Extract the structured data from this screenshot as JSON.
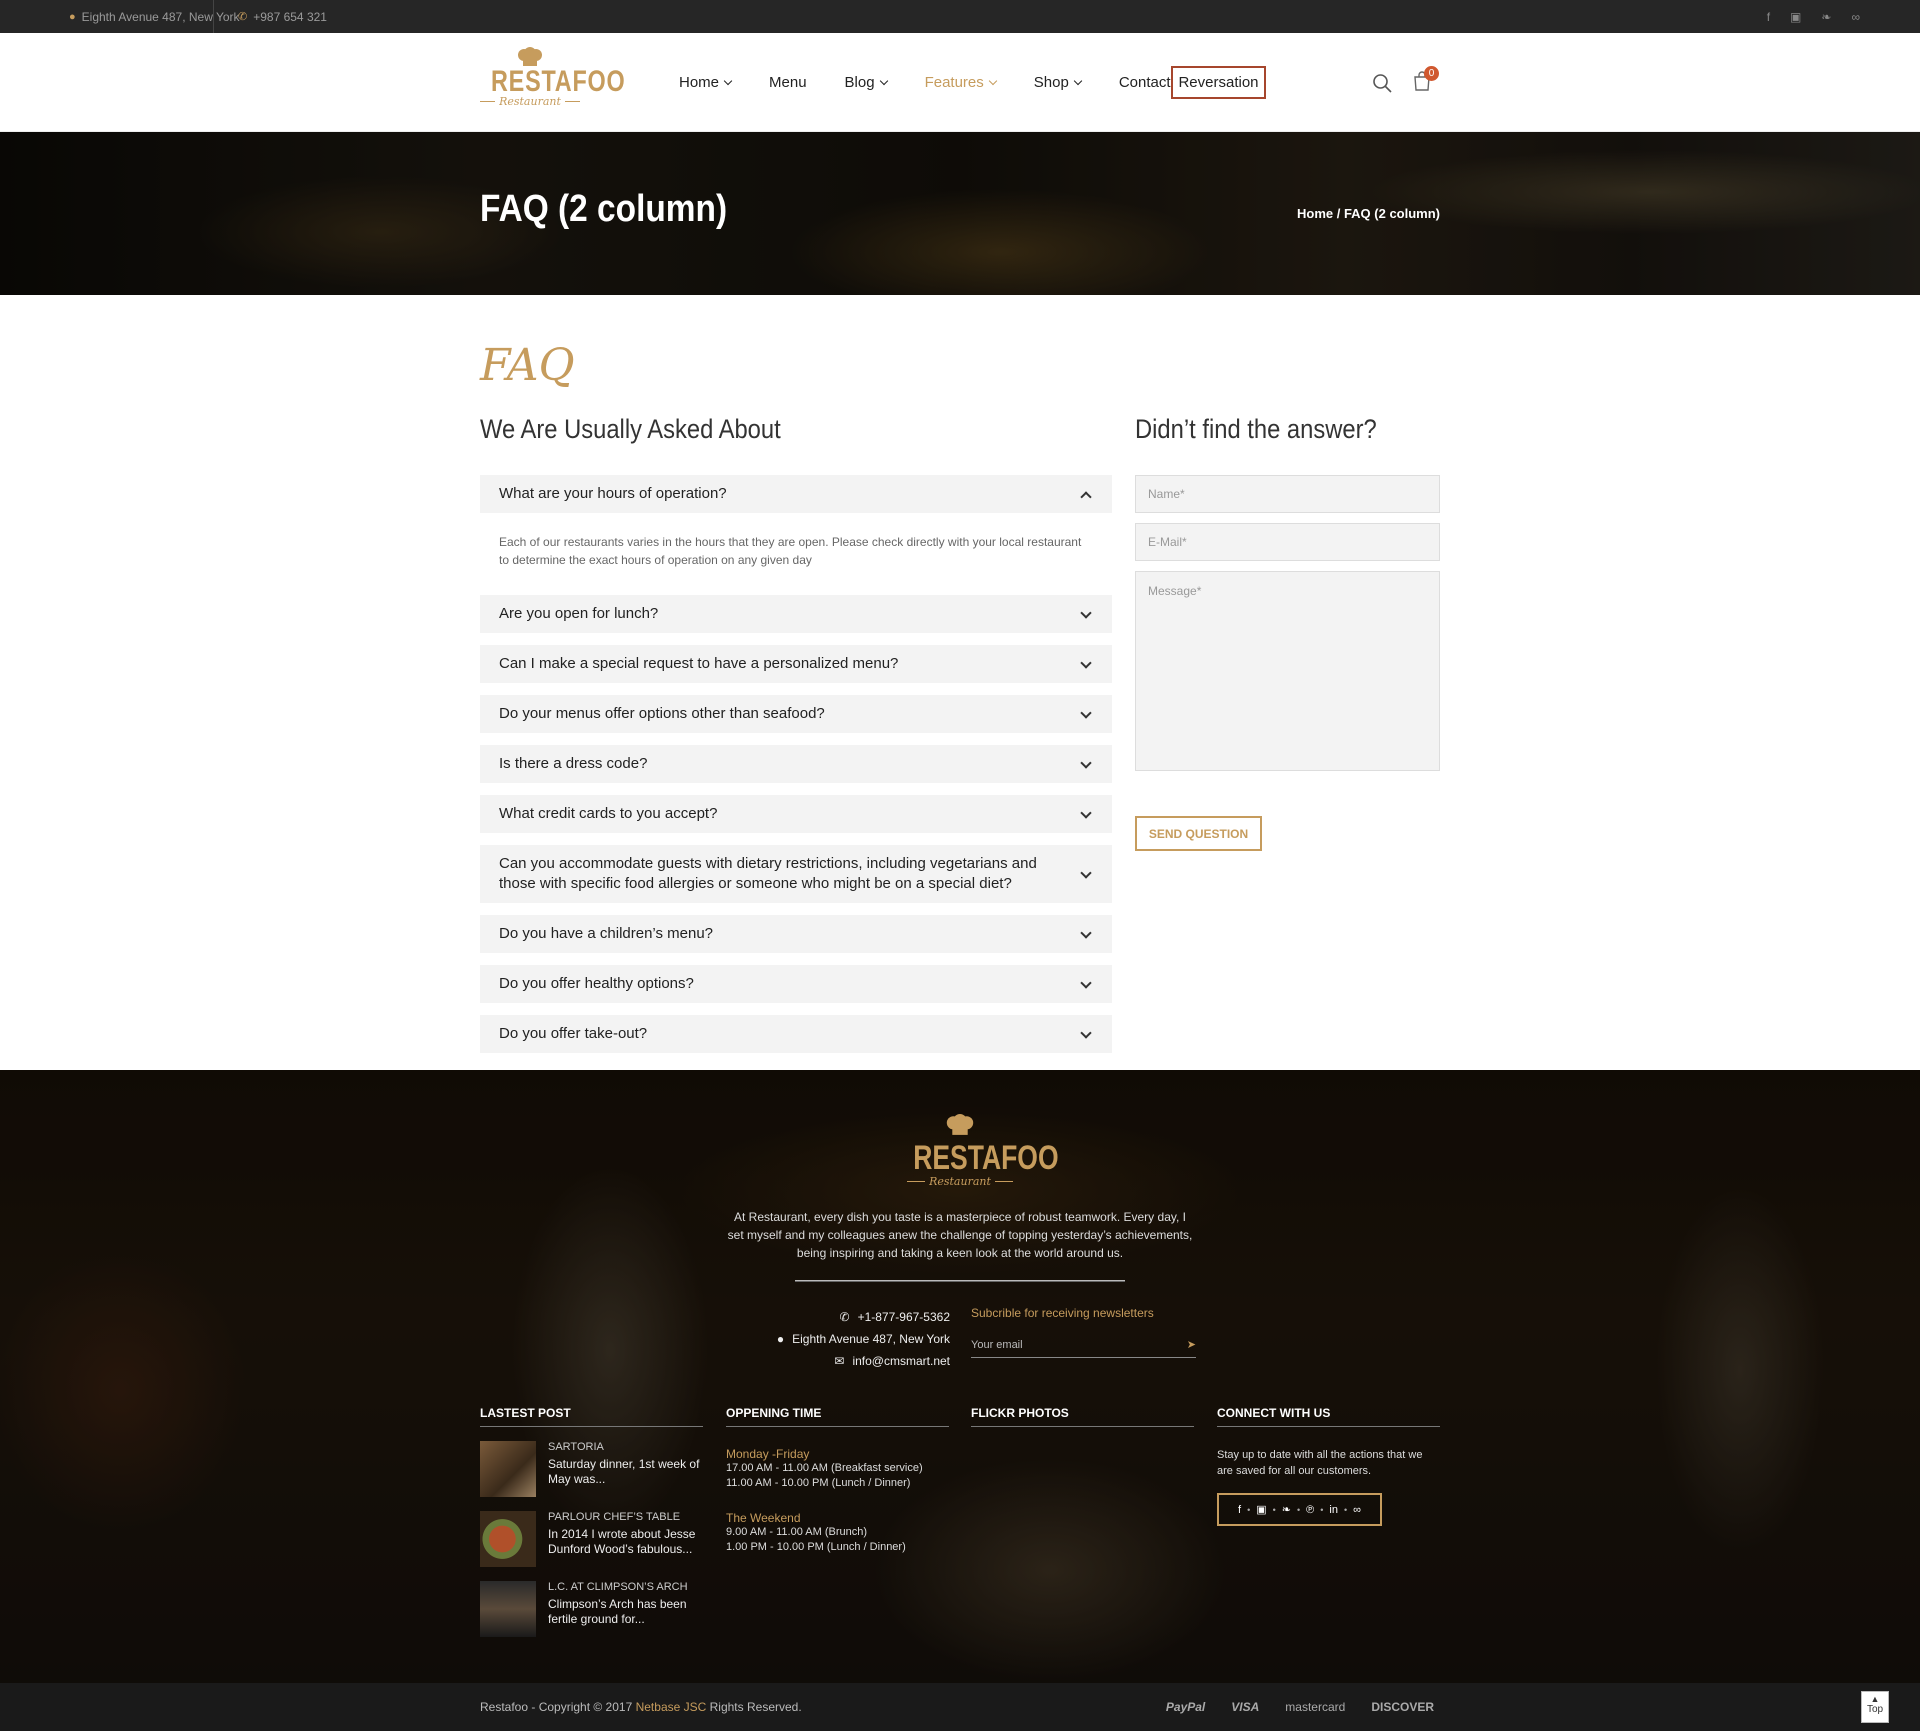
{
  "topbar": {
    "address": "Eighth Avenue 487, New York",
    "phone": "+987 654 321",
    "social_icons": [
      "facebook-icon",
      "instagram-icon",
      "twitter-icon",
      "tripadvisor-icon"
    ]
  },
  "header": {
    "logo_brand": "RESTAFOO",
    "logo_sub": "Restaurant",
    "nav": [
      {
        "label": "Home",
        "dropdown": true
      },
      {
        "label": "Menu",
        "dropdown": false
      },
      {
        "label": "Blog",
        "dropdown": true
      },
      {
        "label": "Features",
        "dropdown": true,
        "active": true
      },
      {
        "label": "Shop",
        "dropdown": true
      },
      {
        "label": "Contact",
        "dropdown": true
      }
    ],
    "reservation_label": "Reversation",
    "cart_count": "0"
  },
  "banner": {
    "title": "FAQ (2 column)",
    "breadcrumb": "Home / FAQ (2 column)"
  },
  "faq": {
    "script_title": "FAQ",
    "heading": "We Are Usually Asked About",
    "items": [
      {
        "q": "What are your hours of operation?",
        "open": true,
        "a": "Each of our restaurants varies in the hours that they are open. Please check directly with your local restaurant to determine the exact hours of operation on any given day"
      },
      {
        "q": "Are you open for lunch?"
      },
      {
        "q": "Can I make a special request to have a personalized menu?"
      },
      {
        "q": "Do your menus offer options other than seafood?"
      },
      {
        "q": "Is there a dress code?"
      },
      {
        "q": "What credit cards to you accept?"
      },
      {
        "q": "Can you accommodate guests with dietary restrictions, including vegetarians and those with specific food allergies or someone who might be on a special diet?"
      },
      {
        "q": "Do you have a children’s menu?"
      },
      {
        "q": "Do you offer healthy options?"
      },
      {
        "q": "Do you offer take-out?"
      }
    ]
  },
  "form": {
    "heading": "Didn’t find the answer?",
    "name_placeholder": "Name*",
    "email_placeholder": "E-Mail*",
    "message_placeholder": "Message*",
    "submit_label": "SEND QUESTION"
  },
  "footer": {
    "logo_brand": "RESTAFOO",
    "logo_sub": "Restaurant",
    "about": "At Restaurant, every dish you taste is a masterpiece of robust teamwork. Every day, I set myself and my colleagues anew the challenge of topping yesterday’s achievements, being inspiring and taking a keen look at the world around us.",
    "phone": "+1-877-967-5362",
    "address": "Eighth Avenue 487, New York",
    "email": "info@cmsmart.net",
    "newsletter_label": "Subcrible for receiving newsletters",
    "newsletter_placeholder": "Your email",
    "latest_post_title": "LASTEST POST",
    "posts": [
      {
        "title": "SARTORIA",
        "excerpt": "Saturday dinner, 1st week of May was..."
      },
      {
        "title": "PARLOUR CHEF’S TABLE",
        "excerpt": "In 2014 I wrote about Jesse Dunford Wood’s fabulous..."
      },
      {
        "title": "L.C. AT CLIMPSON’S ARCH",
        "excerpt": "Climpson’s Arch has been fertile ground for..."
      }
    ],
    "opening_title": "OPPENING TIME",
    "opening": [
      {
        "day": "Monday -Friday",
        "lines": [
          "17.00 AM - 11.00 AM (Breakfast service)",
          "11.00 AM - 10.00 PM (Lunch / Dinner)"
        ]
      },
      {
        "day": "The Weekend",
        "lines": [
          "9.00 AM - 11.00 AM (Brunch)",
          "1.00 PM - 10.00 PM (Lunch / Dinner)"
        ]
      }
    ],
    "flickr_title": "FLICKR PHOTOS",
    "connect_title": "CONNECT WITH US",
    "connect_text": "Stay up to date with all the actions that we are saved for all our customers.",
    "connect_icons": [
      "f",
      "◙",
      "🐦",
      "℗",
      "in",
      "∞"
    ]
  },
  "bottom": {
    "copyright_pre": "Restafoo - Copyright © 2017 ",
    "copyright_link": "Netbase JSC",
    "copyright_post": " Rights Reserved.",
    "payments": [
      "PayPal",
      "VISA",
      "mastercard",
      "DISCOVER"
    ],
    "top_label": "Top"
  },
  "colors": {
    "accent": "#c69c5d",
    "dark": "#262626",
    "reserve_border": "#a6462d",
    "cart_badge": "#d0582f"
  }
}
